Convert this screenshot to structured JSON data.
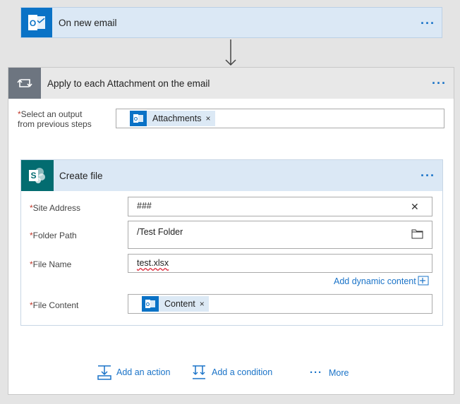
{
  "trigger": {
    "title": "On new email",
    "logo_text": "O"
  },
  "foreach": {
    "title": "Apply to each Attachment on the email",
    "select_label_line1": "Select an output",
    "select_label_line2": "from previous steps",
    "token": {
      "label": "Attachments",
      "remove": "×"
    }
  },
  "create_file": {
    "title": "Create file",
    "fields": {
      "site_address": {
        "label": "Site Address",
        "value": "###",
        "clear": "✕"
      },
      "folder_path": {
        "label": "Folder Path",
        "value": "/Test Folder"
      },
      "file_name": {
        "label": "File Name",
        "value": "test.xlsx"
      },
      "file_content": {
        "label": "File Content",
        "token_label": "Content",
        "token_remove": "×"
      }
    },
    "dynamic_link": "Add dynamic content"
  },
  "required_marker": "*",
  "menu_dots": "···",
  "actions": {
    "add_action": "Add an action",
    "add_condition": "Add a condition",
    "more": "More",
    "more_dots": "···"
  },
  "colors": {
    "accent": "#1a73c8",
    "outlook_blue": "#0a72c6",
    "sharepoint_teal": "#036c70",
    "loop_gray": "#6d7580"
  }
}
